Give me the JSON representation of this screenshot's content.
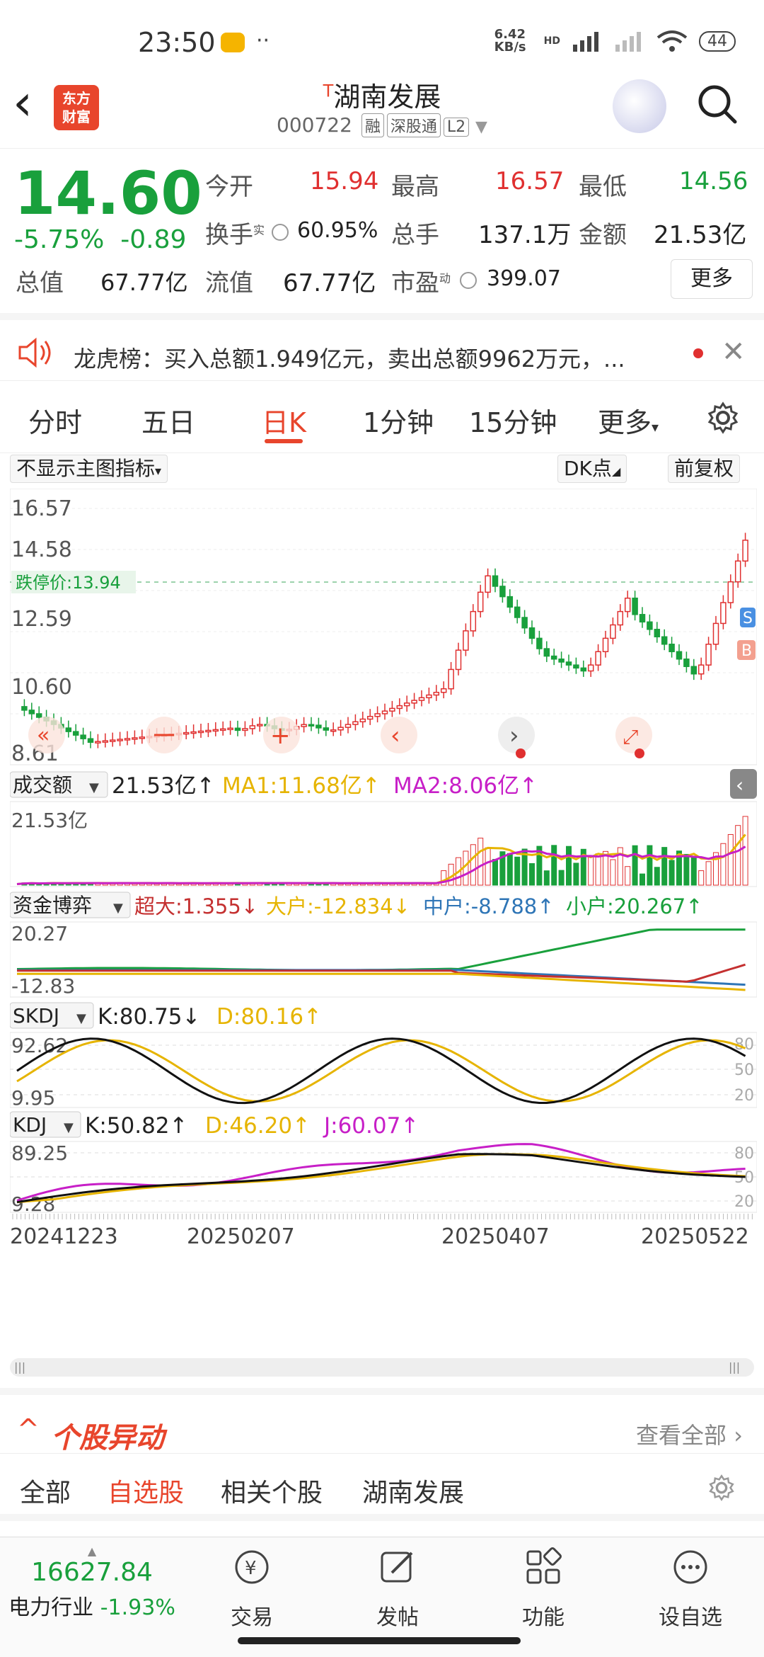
{
  "status": {
    "time": "23:50",
    "speed": "6.42 KB/s",
    "battery": "44",
    "hd": "HD"
  },
  "header": {
    "title": "湖南发展",
    "code": "000722",
    "tags": [
      "融",
      "深股通",
      "L2"
    ],
    "logo_line1": "东方",
    "logo_line2": "财富"
  },
  "quote": {
    "price": "14.60",
    "change_pct": "-5.75%",
    "change": "-0.89",
    "open_label": "今开",
    "open": "15.94",
    "high_label": "最高",
    "high": "16.57",
    "low_label": "最低",
    "low": "14.56",
    "turnover_label": "换手",
    "turnover_sup": "实",
    "turnover": "60.95%",
    "volume_label": "总手",
    "volume": "137.1万",
    "amount_label": "金额",
    "amount": "21.53亿",
    "mktcap_label": "总值",
    "mktcap": "67.77亿",
    "float_label": "流值",
    "float": "67.77亿",
    "pe_label": "市盈",
    "pe_sup": "动",
    "pe": "399.07",
    "more": "更多"
  },
  "notice": {
    "text": "龙虎榜：买入总额1.949亿元，卖出总额9962万元，..."
  },
  "tabs": [
    "分时",
    "五日",
    "日K",
    "1分钟",
    "15分钟",
    "更多"
  ],
  "active_tab": "日K",
  "chart_toolbar": {
    "indicator": "不显示主图指标",
    "dk": "DK点",
    "adjust": "前复权"
  },
  "main_chart": {
    "y_labels": [
      "16.57",
      "14.58",
      "12.59",
      "10.60",
      "8.61"
    ],
    "limit_down": "跌停价:13.94",
    "b_marker": "B",
    "s_marker": "S"
  },
  "volume_panel": {
    "label": "成交额",
    "value": "21.53亿↑",
    "ma1": "MA1:11.68亿↑",
    "ma2": "MA2:8.06亿↑",
    "ymax": "21.53亿"
  },
  "fund_panel": {
    "label": "资金博弈",
    "super": "超大:1.355↓",
    "big": "大户:-12.834↓",
    "mid": "中户:-8.788↑",
    "small": "小户:20.267↑",
    "ymax": "20.27",
    "ymin": "-12.83"
  },
  "skdj_panel": {
    "label": "SKDJ",
    "k": "K:80.75↓",
    "d": "D:80.16↑",
    "ymax": "92.62",
    "ymin": "9.95",
    "r80": "80",
    "r50": "50",
    "r20": "20"
  },
  "kdj_panel": {
    "label": "KDJ",
    "k": "K:50.82↑",
    "d": "D:46.20↑",
    "j": "J:60.07↑",
    "ymax": "89.25",
    "ymin": "9.28",
    "r80": "80",
    "r50": "50",
    "r20": "20"
  },
  "dates": [
    "20241223",
    "20250207",
    "20250407",
    "20250522"
  ],
  "section": {
    "title": "个股异动",
    "more": "查看全部"
  },
  "subtabs": [
    "全部",
    "自选股",
    "相关个股",
    "湖南发展"
  ],
  "active_subtab": "自选股",
  "bottom": {
    "index_value": "16627.84",
    "index_name": "电力行业",
    "index_change": "-1.93%",
    "nav": [
      "交易",
      "发帖",
      "功能",
      "设自选"
    ]
  },
  "colors": {
    "up": "#e03030",
    "down": "#19a03c",
    "accent": "#e8452c"
  }
}
